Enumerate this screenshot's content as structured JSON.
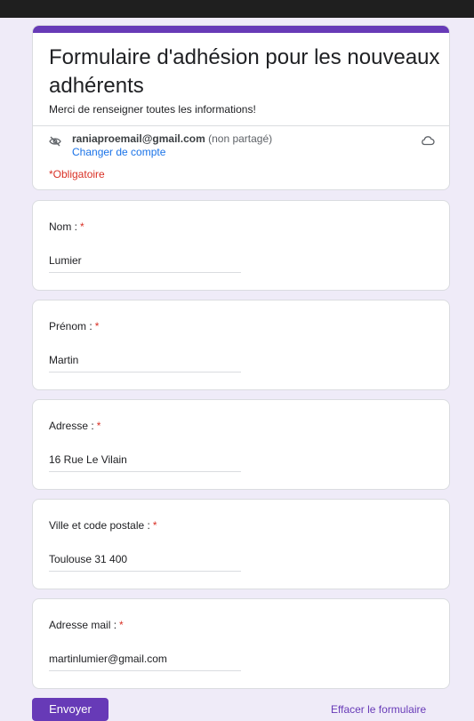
{
  "form": {
    "title": "Formulaire d'adhésion pour les nouveaux adhérents",
    "description": "Merci de renseigner toutes les informations!",
    "account_email": "raniaproemail@gmail.com",
    "account_note": "(non partagé)",
    "switch_account": "Changer de compte",
    "required_note": "*Obligatoire",
    "accent_color": "#673ab7",
    "icons": {
      "hidden": "eye-off-icon",
      "cloud": "cloud-icon"
    }
  },
  "questions": [
    {
      "label": "Nom :",
      "star": "*",
      "value": "Lumier"
    },
    {
      "label": "Prénom :",
      "star": "*",
      "value": "Martin"
    },
    {
      "label": "Adresse :",
      "star": "*",
      "value": "16 Rue Le Vilain"
    },
    {
      "label": "Ville et code postale :",
      "star": "*",
      "value": "Toulouse 31 400"
    },
    {
      "label": "Adresse mail :",
      "star": "*",
      "value": "martinlumier@gmail.com"
    }
  ],
  "actions": {
    "submit": "Envoyer",
    "clear": "Effacer le formulaire"
  }
}
